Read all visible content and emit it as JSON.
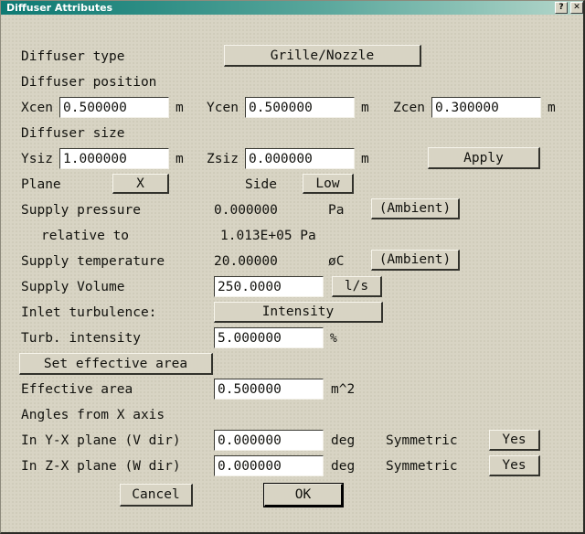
{
  "window": {
    "title": "Diffuser Attributes",
    "help_button": "?",
    "close_button": "✕"
  },
  "form": {
    "diffuser_type_label": "Diffuser type",
    "diffuser_type_value": "Grille/Nozzle",
    "diffuser_position_label": "Diffuser position",
    "xcen_label": "Xcen",
    "xcen_value": "0.500000",
    "xcen_unit": "m",
    "ycen_label": "Ycen",
    "ycen_value": "0.500000",
    "ycen_unit": "m",
    "zcen_label": "Zcen",
    "zcen_value": "0.300000",
    "zcen_unit": "m",
    "diffuser_size_label": "Diffuser size",
    "ysiz_label": "Ysiz",
    "ysiz_value": "1.000000",
    "ysiz_unit": "m",
    "zsiz_label": "Zsiz",
    "zsiz_value": "0.000000",
    "zsiz_unit": "m",
    "apply_label": "Apply",
    "plane_label": "Plane",
    "plane_value": "X",
    "side_label": "Side",
    "side_value": "Low",
    "supply_pressure_label": "Supply pressure",
    "supply_pressure_value": "0.000000",
    "supply_pressure_unit": "Pa",
    "supply_pressure_ambient": "(Ambient)",
    "relative_to_label": "relative to",
    "relative_to_value": "1.013E+05 Pa",
    "supply_temperature_label": "Supply temperature",
    "supply_temperature_value": "20.00000",
    "supply_temperature_unit": "øC",
    "supply_temperature_ambient": "(Ambient)",
    "supply_volume_label": "Supply Volume",
    "supply_volume_value": "250.0000",
    "supply_volume_unit": "l/s",
    "inlet_turbulence_label": "Inlet turbulence:",
    "inlet_turbulence_value": "Intensity",
    "turb_intensity_label": "Turb. intensity",
    "turb_intensity_value": "5.000000",
    "turb_intensity_unit": "%",
    "set_effective_area_label": "Set effective area",
    "effective_area_label": "Effective area",
    "effective_area_value": "0.500000",
    "effective_area_unit": "m^2",
    "angles_header": "Angles from X axis",
    "yx_plane_label": "In Y-X plane (V dir)",
    "yx_plane_value": "0.000000",
    "yx_plane_unit": "deg",
    "yx_symmetric_label": "Symmetric",
    "yx_symmetric_value": "Yes",
    "zx_plane_label": "In Z-X plane (W dir)",
    "zx_plane_value": "0.000000",
    "zx_plane_unit": "deg",
    "zx_symmetric_label": "Symmetric",
    "zx_symmetric_value": "Yes"
  },
  "footer": {
    "cancel_label": "Cancel",
    "ok_label": "OK"
  },
  "colors": {
    "window_bg": "#d8d4c4",
    "titlebar_start": "#0d7a73",
    "titlebar_end": "#b6d7cb",
    "field_bg": "#ffffff",
    "text": "#12120e"
  }
}
